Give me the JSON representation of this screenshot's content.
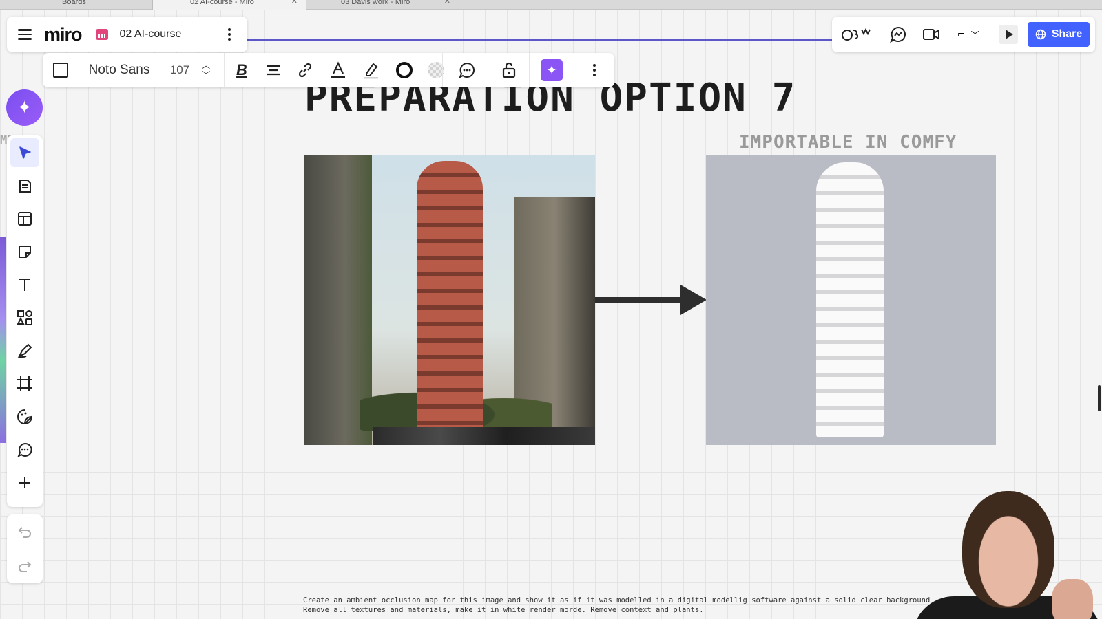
{
  "browser": {
    "tabs": [
      {
        "label": "Boards",
        "active": false
      },
      {
        "label": "02 AI-course - Miro",
        "active": true
      },
      {
        "label": "03 Davis work - Miro",
        "active": false
      }
    ]
  },
  "board": {
    "logo": "miro",
    "title": "02 AI-course"
  },
  "format_toolbar": {
    "font_name": "Noto Sans",
    "font_size": "107",
    "icons": [
      "shape-icon",
      "bold-icon",
      "align-icon",
      "link-icon",
      "text-color-icon",
      "highlight-icon",
      "border-icon",
      "fill-icon",
      "comment-icon",
      "lock-icon",
      "ai-icon",
      "more-icon"
    ]
  },
  "right_panel": {
    "share_label": "Share",
    "icons": [
      "reactions-icon",
      "chat-icon",
      "video-icon",
      "cursor-icon",
      "present-icon"
    ]
  },
  "canvas": {
    "heading": "PREPARATION OPTION 7",
    "subheading": "IMPORTABLE IN COMFY",
    "side_fragment": "MEY",
    "prompt_line_1": "Create an ambient occlusion map for this image and show it as if it was modelled in a digital modellig software against a solid clear background",
    "prompt_line_2": "Remove all textures and materials, make it in white render morde. Remove context and plants."
  },
  "left_toolbar": {
    "tools": [
      "select-icon",
      "note-doc-icon",
      "templates-icon",
      "sticky-note-icon",
      "text-icon",
      "shapes-icon",
      "pen-icon",
      "frame-icon",
      "sticker-icon",
      "comment-icon",
      "add-icon"
    ],
    "history": [
      "undo-icon",
      "redo-icon"
    ]
  },
  "colors": {
    "accent": "#4262ff",
    "ai_purple": "#8a55f4",
    "canvas": "#f4f4f4"
  }
}
